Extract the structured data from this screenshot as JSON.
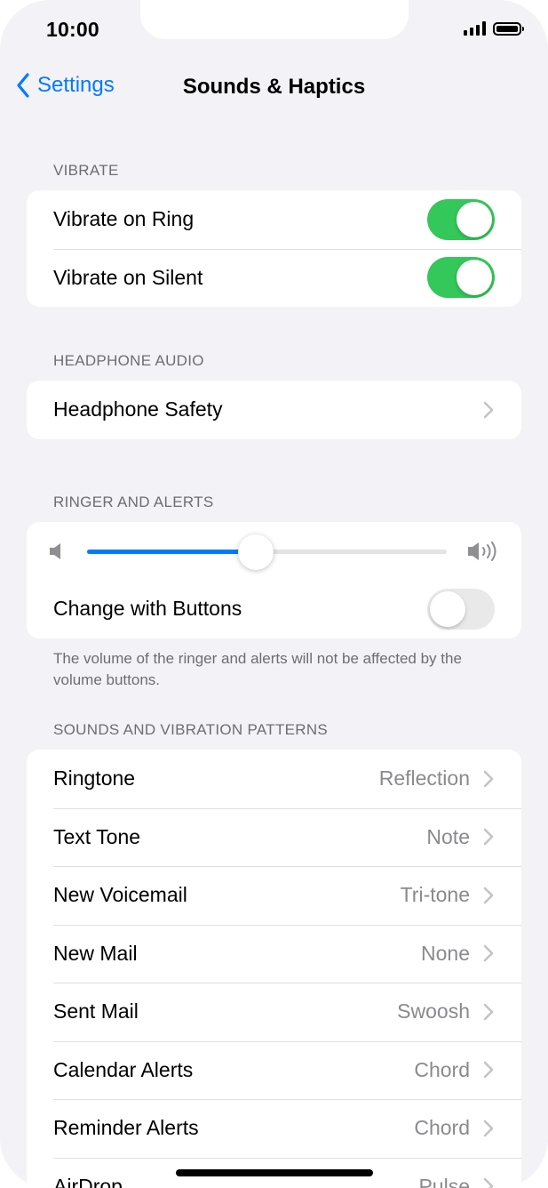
{
  "status": {
    "time": "10:00"
  },
  "nav": {
    "back_label": "Settings",
    "title": "Sounds & Haptics"
  },
  "vibrate": {
    "header": "VIBRATE",
    "rows": [
      {
        "label": "Vibrate on Ring",
        "on": true
      },
      {
        "label": "Vibrate on Silent",
        "on": true
      }
    ]
  },
  "headphone": {
    "header": "HEADPHONE AUDIO",
    "rows": [
      {
        "label": "Headphone Safety"
      }
    ]
  },
  "ringer": {
    "header": "RINGER AND ALERTS",
    "volume_fraction": 0.47,
    "change_with_buttons": {
      "label": "Change with Buttons",
      "on": false
    },
    "note": "The volume of the ringer and alerts will not be affected by the volume buttons."
  },
  "sounds": {
    "header": "SOUNDS AND VIBRATION PATTERNS",
    "rows": [
      {
        "label": "Ringtone",
        "value": "Reflection"
      },
      {
        "label": "Text Tone",
        "value": "Note"
      },
      {
        "label": "New Voicemail",
        "value": "Tri-tone"
      },
      {
        "label": "New Mail",
        "value": "None"
      },
      {
        "label": "Sent Mail",
        "value": "Swoosh"
      },
      {
        "label": "Calendar Alerts",
        "value": "Chord"
      },
      {
        "label": "Reminder Alerts",
        "value": "Chord"
      },
      {
        "label": "AirDrop",
        "value": "Pulse"
      }
    ]
  },
  "colors": {
    "accent": "#007aff",
    "toggle_on": "#34c759",
    "background": "#f2f2f7"
  }
}
